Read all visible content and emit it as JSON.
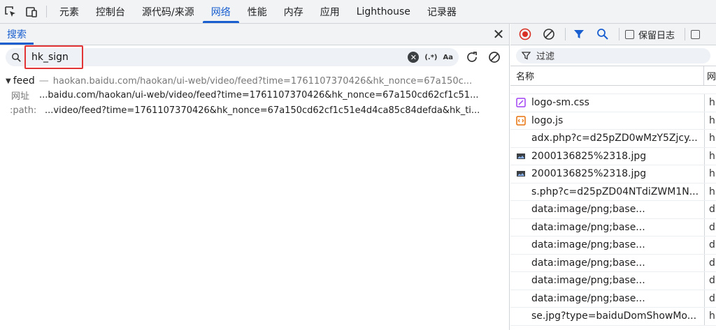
{
  "tabs": [
    {
      "label": "元素"
    },
    {
      "label": "控制台"
    },
    {
      "label": "源代码/来源"
    },
    {
      "label": "网络",
      "active": true
    },
    {
      "label": "性能"
    },
    {
      "label": "内存"
    },
    {
      "label": "应用"
    },
    {
      "label": "Lighthouse"
    },
    {
      "label": "记录器"
    }
  ],
  "search_panel": {
    "tab_label": "搜索",
    "query": "hk_sign",
    "regex_label": "(.*)",
    "case_label": "Aa",
    "result": {
      "file": "feed",
      "url": "haokan.baidu.com/haokan/ui-web/video/feed?time=1761107370426&hk_nonce=67a150c...",
      "lines": [
        {
          "label": "网址",
          "value": "...baidu.com/haokan/ui-web/video/feed?time=1761107370426&hk_nonce=67a150cd62cf1c51..."
        },
        {
          "label": ":path:",
          "value": "...video/feed?time=1761107370426&hk_nonce=67a150cd62cf1c51e4d4ca85c84defda&hk_ti..."
        }
      ]
    }
  },
  "network": {
    "preserve_log_label": "保留日志",
    "filter_placeholder": "过滤",
    "col_name": "名称",
    "col_second": "网",
    "rows": [
      {
        "name": "logo-sm.css",
        "icon": "css-file-icon",
        "col2": "h"
      },
      {
        "name": "logo.js",
        "icon": "js-file-icon",
        "col2": "h"
      },
      {
        "name": "adx.php?c=d25pZD0wMzY5Zjcy...",
        "icon": "none",
        "col2": "h"
      },
      {
        "name": "2000136825%2318.jpg",
        "icon": "image-file-icon",
        "col2": "h"
      },
      {
        "name": "2000136825%2318.jpg",
        "icon": "image-file-icon",
        "col2": "h"
      },
      {
        "name": "s.php?c=d25pZD04NTdiZWM1N...",
        "icon": "none",
        "col2": "h"
      },
      {
        "name": "data:image/png;base...",
        "icon": "none",
        "col2": "d"
      },
      {
        "name": "data:image/png;base...",
        "icon": "none",
        "col2": "d"
      },
      {
        "name": "data:image/png;base...",
        "icon": "none",
        "col2": "d"
      },
      {
        "name": "data:image/png;base...",
        "icon": "none",
        "col2": "d"
      },
      {
        "name": "data:image/png;base...",
        "icon": "none",
        "col2": "d"
      },
      {
        "name": "data:image/png;base...",
        "icon": "none",
        "col2": "d"
      },
      {
        "name": "se.jpg?type=baiduDomShowMo...",
        "icon": "none",
        "col2": "h"
      }
    ]
  },
  "colors": {
    "accent": "#1a5fd0",
    "record": "#d93025",
    "highlight_box": "#e23434"
  }
}
